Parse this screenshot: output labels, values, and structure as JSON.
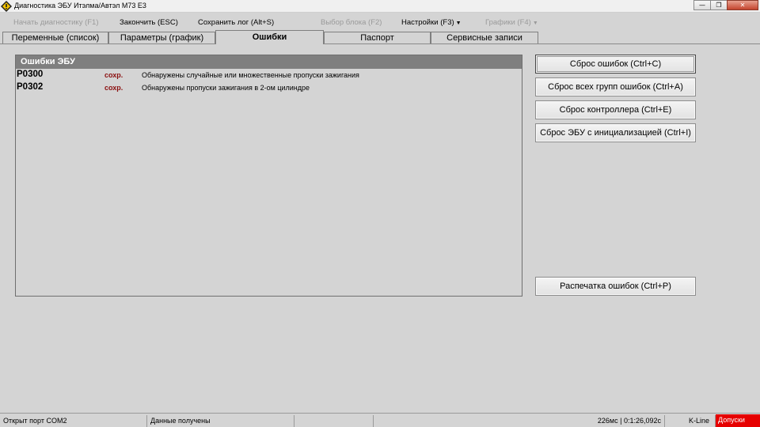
{
  "window": {
    "title": "Диагностика ЭБУ Итэлма/Автэл М73 Е3",
    "app_icon": "yellow-diamond-icon",
    "controls": {
      "minimize": "minimize-icon",
      "maximize": "restore-icon",
      "close": "close-icon"
    }
  },
  "menu": {
    "start": "Начать диагностику (F1)",
    "finish": "Закончить (ESC)",
    "save_log": "Сохранить лог (Alt+S)",
    "select_block": "Выбор блока (F2)",
    "settings": "Настройки (F3)",
    "graphs": "Графики (F4)"
  },
  "tabs": [
    {
      "label": "Переменные (список)",
      "active": false
    },
    {
      "label": "Параметры (график)",
      "active": false
    },
    {
      "label": "Ошибки",
      "active": true
    },
    {
      "label": "Паспорт",
      "active": false
    },
    {
      "label": "Сервисные записи",
      "active": false
    }
  ],
  "errors_panel": {
    "title": "Ошибки ЭБУ",
    "rows": [
      {
        "code": "P0300",
        "state": "сохр.",
        "description": "Обнаружены случайные или множественные пропуски зажигания"
      },
      {
        "code": "P0302",
        "state": "сохр.",
        "description": "Обнаружены пропуски зажигания в 2-ом цилиндре"
      }
    ]
  },
  "buttons": {
    "reset_errors": "Сброс ошибок (Ctrl+C)",
    "reset_all_groups": "Сброс всех групп ошибок (Ctrl+A)",
    "reset_controller": "Сброс контроллера (Ctrl+E)",
    "reset_ecu_init": "Сброс ЭБУ с инициализацией (Ctrl+I)",
    "print_errors": "Распечатка ошибок (Ctrl+P)"
  },
  "status": {
    "port": "Открыт порт COM2",
    "data": "Данные получены",
    "timing": "226мс | 0:1:26,092с",
    "line": "K-Line",
    "alarm": "Допуски"
  },
  "colors": {
    "error_state": "#8b1010",
    "panel_header": "#7f7f7f",
    "alarm": "#e60000"
  }
}
